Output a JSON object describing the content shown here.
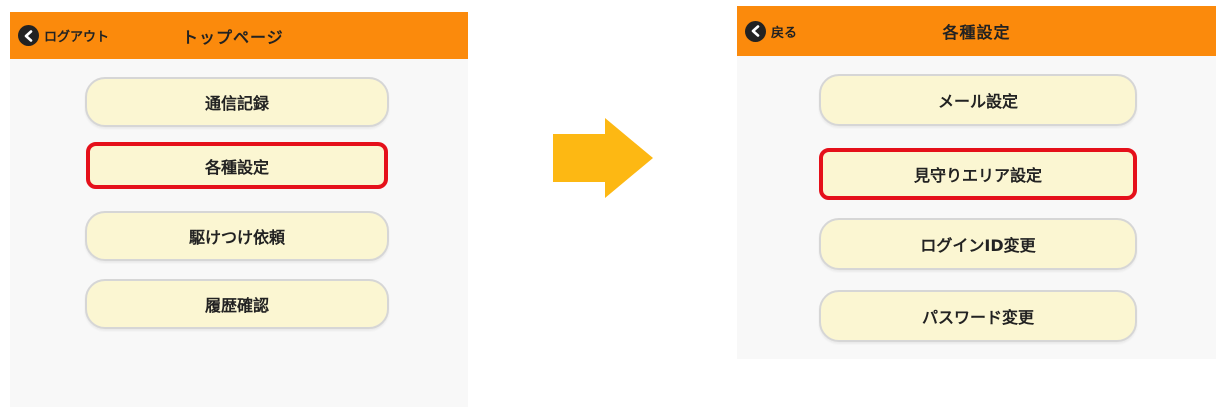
{
  "left_screen": {
    "header": {
      "back_label": "ログアウト",
      "title": "トップページ"
    },
    "menu": [
      {
        "label": "通信記録",
        "highlighted": false
      },
      {
        "label": "各種設定",
        "highlighted": true
      },
      {
        "label": "駆けつけ依頼",
        "highlighted": false
      },
      {
        "label": "履歴確認",
        "highlighted": false
      }
    ]
  },
  "right_screen": {
    "header": {
      "back_label": "戻る",
      "title": "各種設定"
    },
    "menu": [
      {
        "label": "メール設定",
        "highlighted": false
      },
      {
        "label": "見守りエリア設定",
        "highlighted": true
      },
      {
        "label": "ログインID変更",
        "highlighted": false
      },
      {
        "label": "パスワード変更",
        "highlighted": false
      }
    ]
  },
  "colors": {
    "header": "#fb8a0c",
    "button_fill": "#fbf6d2",
    "highlight_border": "#e5101a",
    "arrow": "#fdb813"
  }
}
